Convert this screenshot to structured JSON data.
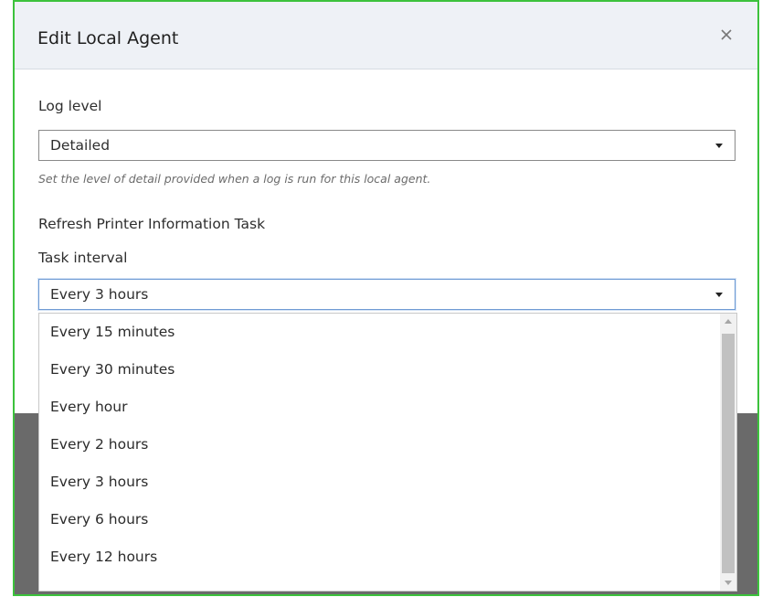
{
  "dialog": {
    "title": "Edit Local Agent",
    "close_icon": "close-icon"
  },
  "log_level": {
    "label": "Log level",
    "value": "Detailed",
    "hint": "Set the level of detail provided when a log is run for this local agent."
  },
  "task_section": {
    "title": "Refresh Printer Information Task"
  },
  "task_interval": {
    "label": "Task interval",
    "value": "Every 3 hours",
    "options": [
      "Every 15 minutes",
      "Every 30 minutes",
      "Every hour",
      "Every 2 hours",
      "Every 3 hours",
      "Every 6 hours",
      "Every 12 hours"
    ]
  },
  "colors": {
    "frame_border": "#3cc23c",
    "header_bg": "#eef1f6",
    "focus_border": "#6f9bd4"
  }
}
